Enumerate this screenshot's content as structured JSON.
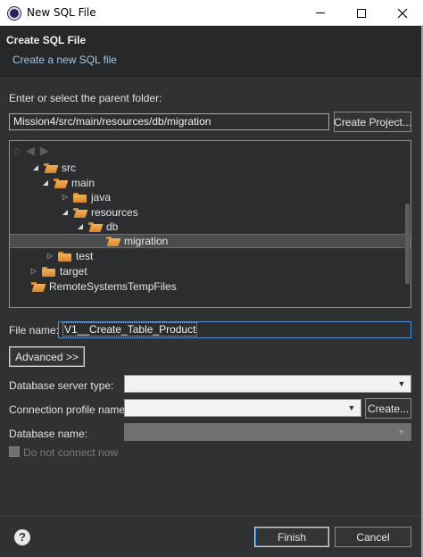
{
  "window": {
    "title": "New SQL File"
  },
  "header": {
    "title": "Create SQL File",
    "subtitle": "Create a new SQL file"
  },
  "parent_folder": {
    "label": "Enter or select the parent folder:",
    "value": "Mission4/src/main/resources/db/migration",
    "create_project_label": "Create Project..."
  },
  "tree": {
    "nav_icons": [
      "home-icon",
      "back-icon",
      "forward-icon"
    ],
    "items": [
      {
        "label": "src",
        "expanded": true
      },
      {
        "label": "main",
        "expanded": true
      },
      {
        "label": "java",
        "expanded": false
      },
      {
        "label": "resources",
        "expanded": true
      },
      {
        "label": "db",
        "expanded": true
      },
      {
        "label": "migration",
        "selected": true
      },
      {
        "label": "test",
        "expanded": false
      },
      {
        "label": "target",
        "expanded": false
      },
      {
        "label": "RemoteSystemsTempFiles"
      }
    ]
  },
  "file_name": {
    "label": "File name:",
    "value": "V1__Create_Table_Product"
  },
  "advanced": {
    "label": "Advanced >>"
  },
  "db_server_type": {
    "label": "Database server type:",
    "value": ""
  },
  "connection_profile": {
    "label": "Connection profile name:",
    "value": "",
    "create_label": "Create..."
  },
  "database_name": {
    "label": "Database name:",
    "value": ""
  },
  "do_not_connect": {
    "label": "Do not connect now",
    "checked": false
  },
  "footer": {
    "finish_label": "Finish",
    "cancel_label": "Cancel",
    "help_glyph": "?"
  },
  "colors": {
    "accent": "#4d8fd0",
    "folder": "#e9a54a",
    "background": "#2f3133"
  }
}
